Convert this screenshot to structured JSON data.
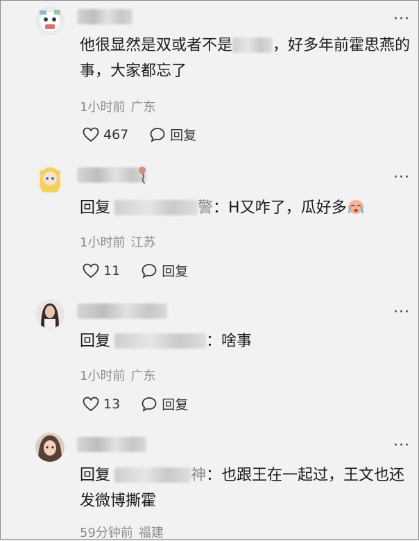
{
  "comments": [
    {
      "text_before": "他很显然是双或者不是",
      "text_after": "，好多年前霍思燕的事，大家都忘了",
      "time": "1小时前",
      "location": "广东",
      "likes": "467",
      "reply_label": "回复"
    },
    {
      "reply_prefix": "回复",
      "name_tail": "警",
      "text": "：H又咋了，瓜好多",
      "emoji": "crying-face-emoji",
      "time": "1小时前",
      "location": "江苏",
      "likes": "11",
      "reply_label": "回复"
    },
    {
      "reply_prefix": "回复",
      "text": "：啥事",
      "time": "1小时前",
      "location": "广东",
      "likes": "13",
      "reply_label": "回复"
    },
    {
      "reply_prefix": "回复",
      "name_tail": "神",
      "text": "：也跟王在一起过，王文也还发微博撕霍",
      "time": "59分钟前",
      "location": "福建"
    }
  ],
  "more_glyph": "···",
  "colors": {
    "background": "#f2f2f2",
    "meta_gray": "#8c8c8c",
    "text": "#1a1a1a"
  }
}
